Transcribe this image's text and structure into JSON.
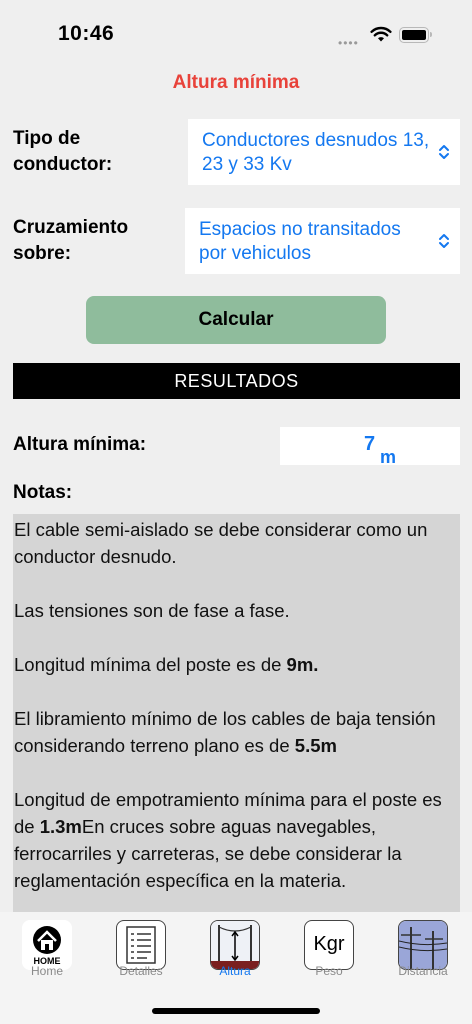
{
  "status": {
    "time": "10:46"
  },
  "title": "Altura mínima",
  "form": {
    "conductor_label": "Tipo de conductor:",
    "conductor_value": "Conductores desnudos 13, 23 y 33 Kv",
    "crossing_label": "Cruzamiento sobre:",
    "crossing_value": "Espacios no transitados por vehiculos",
    "calculate_label": "Calcular"
  },
  "results": {
    "header": "RESULTADOS",
    "height_label": "Altura mínima:",
    "height_value": "7",
    "height_unit": "m",
    "notes_label": "Notas:",
    "notes": {
      "n1": "El cable semi-aislado se debe considerar como un conductor desnudo.",
      "n2": "Las tensiones son de fase a fase.",
      "n3_text": "Longitud mínima del poste es de ",
      "n3_bold": "9m.",
      "n4_text": "El libramiento mínimo de los cables de baja tensión considerando terreno plano es de ",
      "n4_bold": "5.5m",
      "n5_text_a": "Longitud de empotramiento mínima para el poste es de ",
      "n5_bold": "1.3m",
      "n5_text_b": "En cruces sobre aguas navegables, ferrocarriles y carreteras, se debe considerar la reglamentación específica en la materia."
    }
  },
  "tabs": [
    {
      "label": "Home",
      "icon_text": "HOME"
    },
    {
      "label": "Detalles"
    },
    {
      "label": "Altura"
    },
    {
      "label": "Peso",
      "icon_text": "Kgr"
    },
    {
      "label": "Distancia"
    }
  ],
  "colors": {
    "accent": "#1478f0",
    "title": "#e8423a",
    "button": "#8fbc9c"
  }
}
